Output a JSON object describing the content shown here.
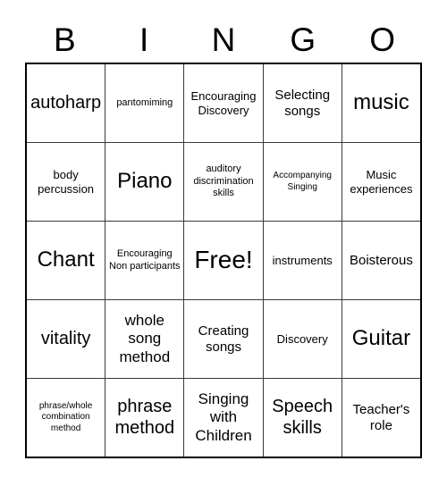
{
  "card": {
    "title": "BINGO",
    "free_space_label": "Free!",
    "colors": {
      "background": "#ffffff",
      "text": "#000000",
      "grid_line": "#3a3a3a",
      "grid_border": "#000000"
    }
  },
  "header": {
    "letters": [
      {
        "label": "B"
      },
      {
        "label": "I"
      },
      {
        "label": "N"
      },
      {
        "label": "G"
      },
      {
        "label": "O"
      }
    ]
  },
  "grid": {
    "columns": 5,
    "rows": 5,
    "cells": [
      [
        {
          "text": "autoharp",
          "size": "2xl",
          "free": false
        },
        {
          "text": "pantomiming",
          "size": "sm",
          "free": false
        },
        {
          "text": "Encouraging Discovery",
          "size": "md",
          "free": false
        },
        {
          "text": "Selecting songs",
          "size": "lg",
          "free": false
        },
        {
          "text": "music",
          "size": "3xl",
          "free": false
        }
      ],
      [
        {
          "text": "body percussion",
          "size": "md",
          "free": false
        },
        {
          "text": "Piano",
          "size": "3xl",
          "free": false
        },
        {
          "text": "auditory discrimination skills",
          "size": "sm",
          "free": false
        },
        {
          "text": "Accompanying Singing",
          "size": "xs",
          "free": false
        },
        {
          "text": "Music experiences",
          "size": "md",
          "free": false
        }
      ],
      [
        {
          "text": "Chant",
          "size": "3xl",
          "free": false
        },
        {
          "text": "Encouraging Non participants",
          "size": "sm",
          "free": false
        },
        {
          "text": "Free!",
          "size": "4xl",
          "free": true
        },
        {
          "text": "instruments",
          "size": "md",
          "free": false
        },
        {
          "text": "Boisterous",
          "size": "lg",
          "free": false
        }
      ],
      [
        {
          "text": "vitality",
          "size": "2xl",
          "free": false
        },
        {
          "text": "whole song method",
          "size": "xl",
          "free": false
        },
        {
          "text": "Creating songs",
          "size": "lg",
          "free": false
        },
        {
          "text": "Discovery",
          "size": "md",
          "free": false
        },
        {
          "text": "Guitar",
          "size": "3xl",
          "free": false
        }
      ],
      [
        {
          "text": "phrase/whole combination method",
          "size": "xs",
          "free": false
        },
        {
          "text": "phrase method",
          "size": "2xl",
          "free": false
        },
        {
          "text": "Singing with Children",
          "size": "xl",
          "free": false
        },
        {
          "text": "Speech skills",
          "size": "2xl",
          "free": false
        },
        {
          "text": "Teacher's role",
          "size": "lg",
          "free": false
        }
      ]
    ]
  }
}
